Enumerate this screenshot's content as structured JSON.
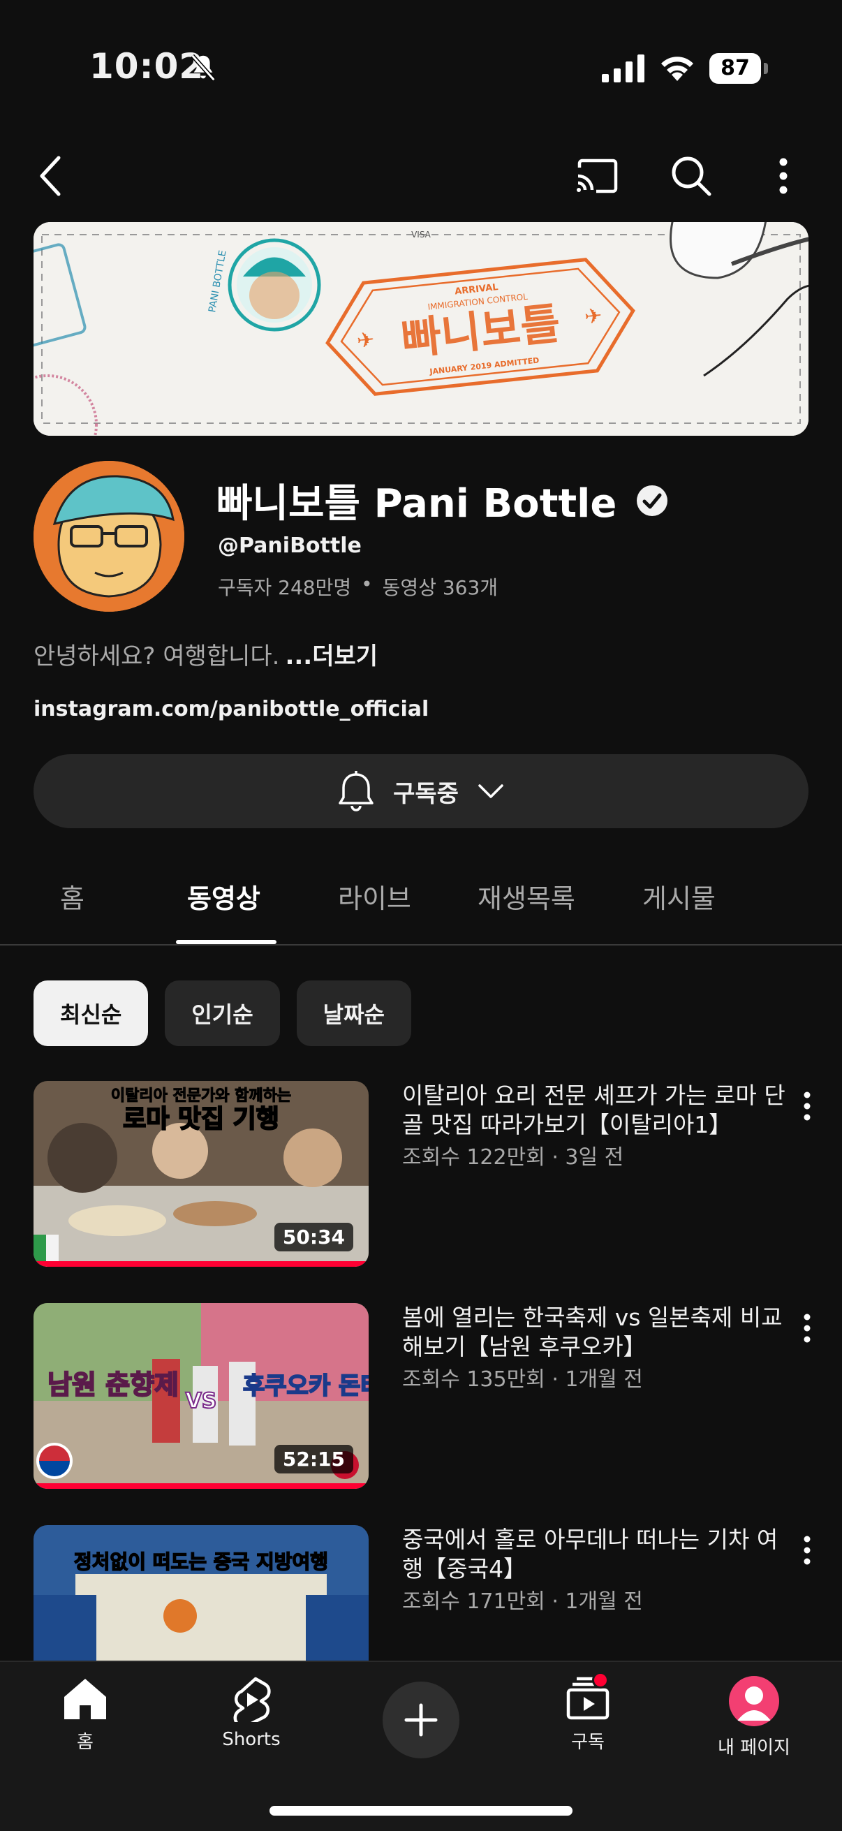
{
  "status_bar": {
    "time": "10:02",
    "battery": "87"
  },
  "banner": {
    "visa_text": "VISA",
    "stamp_top": "ARRIVAL",
    "stamp_sub": "IMMIGRATION CONTROL",
    "stamp_main": "빠니보틀",
    "stamp_bottom": "JANUARY 2019 ADMITTED",
    "side_text": "PANI BOTTLE"
  },
  "channel": {
    "name": "빠니보틀 Pani Bottle",
    "handle": "@PaniBottle",
    "subscribers": "구독자 248만명",
    "separator": "•",
    "videos": "동영상 363개",
    "description": "안녕하세요? 여행합니다.",
    "more": "...더보기",
    "link": "instagram.com/panibottle_official"
  },
  "subscribe": {
    "label": "구독중"
  },
  "tabs": [
    {
      "label": "홈"
    },
    {
      "label": "동영상"
    },
    {
      "label": "라이브"
    },
    {
      "label": "재생목록"
    },
    {
      "label": "게시물"
    }
  ],
  "chips": [
    {
      "label": "최신순"
    },
    {
      "label": "인기순"
    },
    {
      "label": "날짜순"
    }
  ],
  "videos": [
    {
      "title": "이탈리아 요리 전문 셰프가 가는 로마 단골 맛집 따라가보기【이탈리아1】",
      "meta": "조회수 122만회 · 3일 전",
      "duration": "50:34",
      "thumb_text_1": "이탈리아 전문가와 함께하는",
      "thumb_text_2": "로마 맛집 기행"
    },
    {
      "title": "봄에 열리는 한국축제 vs 일본축제 비교해보기【남원  후쿠오카】",
      "meta": "조회수 135만회 · 1개월 전",
      "duration": "52:15",
      "thumb_text_1": "남원 춘향제",
      "thumb_text_2": "후쿠오카 돈타쿠",
      "thumb_vs": "VS"
    },
    {
      "title": "중국에서 홀로 아무데나 떠나는 기차 여행【중국4】",
      "meta": "조회수 171만회 · 1개월 전",
      "thumb_text_1": "정처없이 떠도는 중국 지방여행"
    }
  ],
  "bottom_nav": {
    "home": "홈",
    "shorts": "Shorts",
    "subscriptions": "구독",
    "me": "내 페이지"
  },
  "colors": {
    "background": "#0f0f0f",
    "accent_red": "#ff0033",
    "chip_bg": "#272727",
    "avatar_orange": "#e7792f",
    "me_avatar_pink": "#f33f72"
  }
}
